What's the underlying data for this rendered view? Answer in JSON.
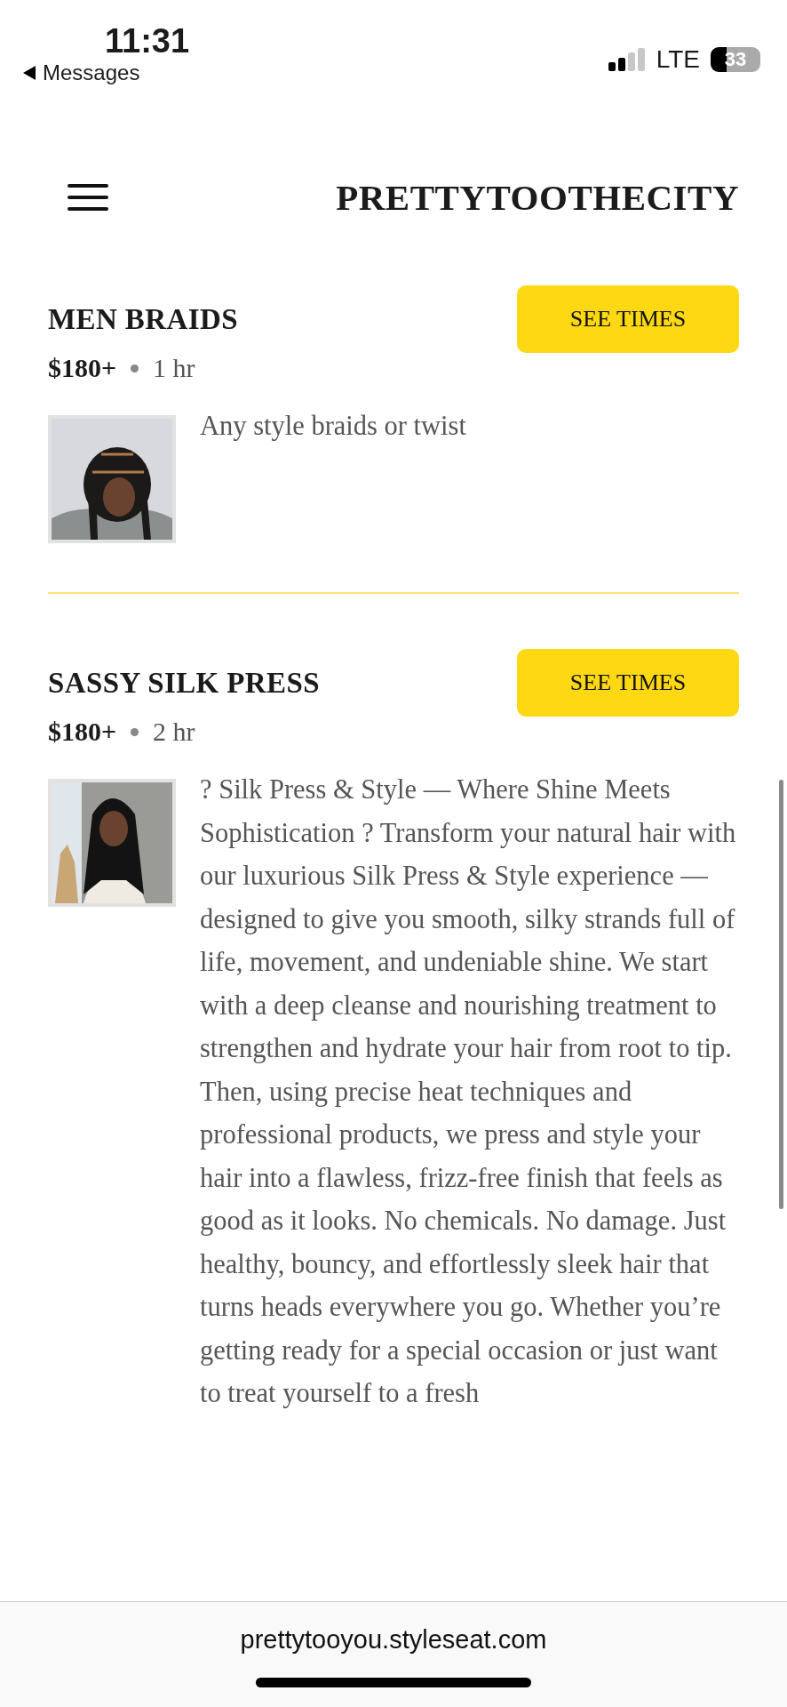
{
  "status_bar": {
    "time": "11:31",
    "back_label": "Messages",
    "network": "LTE",
    "battery": "33"
  },
  "header": {
    "title": "PRETTYTOOTHECITY"
  },
  "services": [
    {
      "name": "MEN BRAIDS",
      "price": "$180+",
      "duration": "1 hr",
      "button": "SEE TIMES",
      "description": "Any style braids or twist"
    },
    {
      "name": "SASSY SILK PRESS",
      "price": "$180+",
      "duration": "2 hr",
      "button": "SEE TIMES",
      "description": "? Silk Press & Style — Where Shine Meets Sophistication ? Transform your natural hair with our luxurious Silk Press & Style experience — designed to give you smooth, silky strands full of life, movement, and undeniable shine. We start with a deep cleanse and nourishing treatment to strengthen and hydrate your hair from root to tip. Then, using precise heat techniques and professional products, we press and style your hair into a flawless, frizz-free finish that feels as good as it looks. No chemicals. No damage. Just healthy, bouncy, and effortlessly sleek hair that turns heads everywhere you go. Whether you’re getting ready for a special occasion or just want to treat yourself to a fresh"
    }
  ],
  "url_bar": {
    "url": "prettytooyou.styleseat.com"
  }
}
